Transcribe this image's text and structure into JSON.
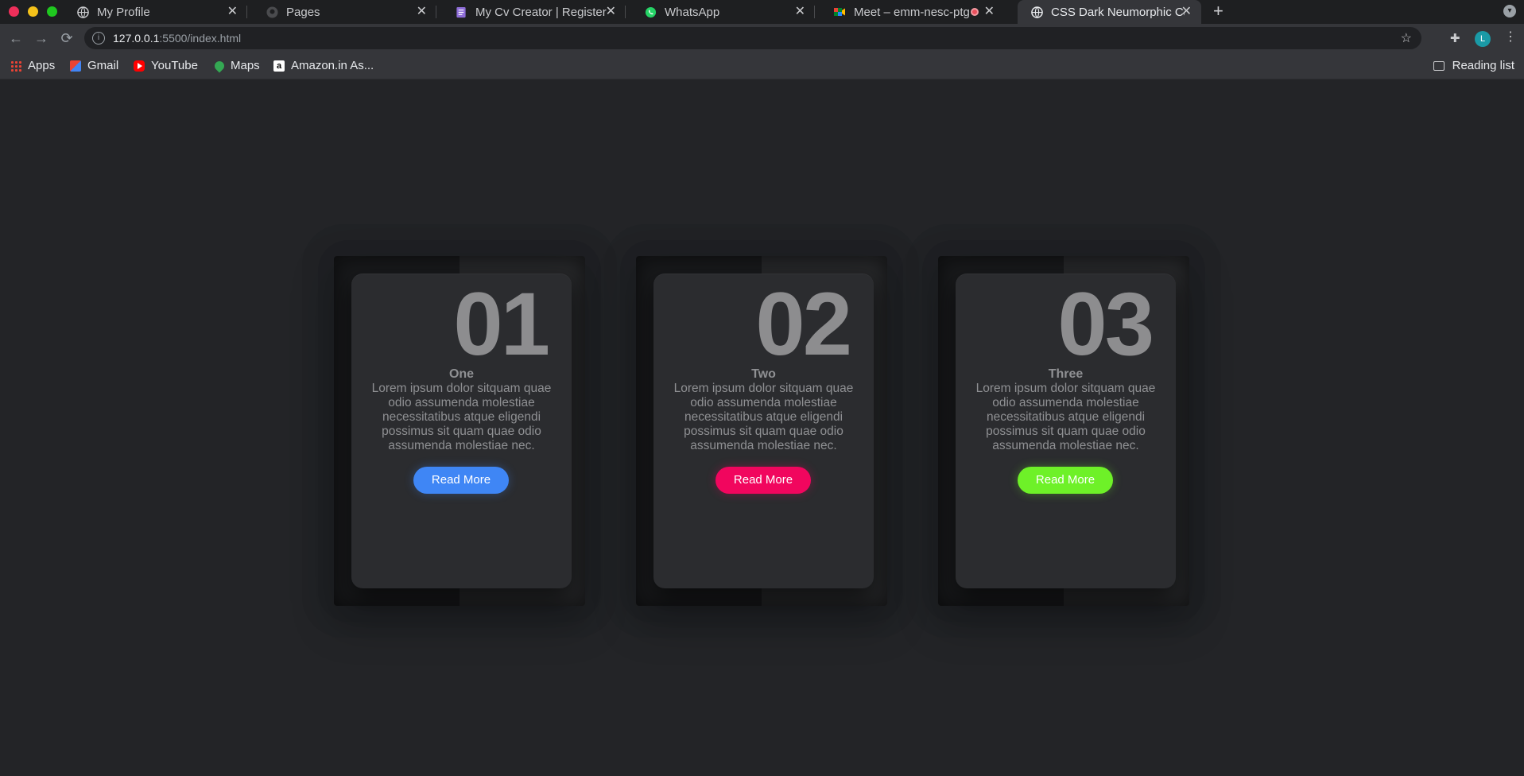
{
  "browser": {
    "tabs": [
      {
        "title": "My Profile",
        "favicon": "globe-icon"
      },
      {
        "title": "Pages",
        "favicon": "github-icon"
      },
      {
        "title": "My Cv Creator | Register",
        "favicon": "form-icon"
      },
      {
        "title": "WhatsApp",
        "favicon": "whatsapp-icon"
      },
      {
        "title": "Meet – emm-nesc-ptg",
        "favicon": "meet-icon"
      },
      {
        "title": "CSS Dark Neumorphic Ca",
        "favicon": "globe-icon"
      }
    ],
    "address": {
      "host": "127.0.0.1",
      "path": ":5500/index.html"
    },
    "profile_initial": "L",
    "bookmarks": [
      {
        "label": "Apps"
      },
      {
        "label": "Gmail"
      },
      {
        "label": "YouTube"
      },
      {
        "label": "Maps"
      },
      {
        "label": "Amazon.in As..."
      }
    ],
    "reading_list": "Reading list"
  },
  "cards": [
    {
      "number": "01",
      "title": "One",
      "text": "Lorem ipsum dolor sitquam quae odio assumenda molestiae necessitatibus atque eligendi possimus sit quam quae odio assumenda molestiae nec.",
      "button": "Read More",
      "color": "#3f86f5"
    },
    {
      "number": "02",
      "title": "Two",
      "text": "Lorem ipsum dolor sitquam quae odio assumenda molestiae necessitatibus atque eligendi possimus sit quam quae odio assumenda molestiae nec.",
      "button": "Read More",
      "color": "#f1065e"
    },
    {
      "number": "03",
      "title": "Three",
      "text": "Lorem ipsum dolor sitquam quae odio assumenda molestiae necessitatibus atque eligendi possimus sit quam quae odio assumenda molestiae nec.",
      "button": "Read More",
      "color": "#6ef128"
    }
  ]
}
